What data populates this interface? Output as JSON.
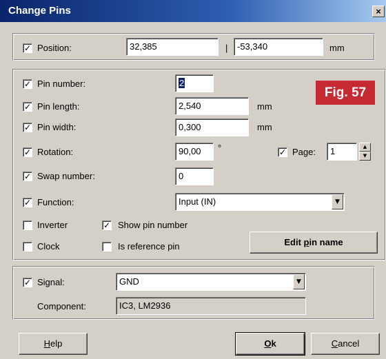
{
  "window": {
    "title": "Change Pins",
    "close_glyph": "×"
  },
  "badge": {
    "text": "Fig. 57",
    "color": "#c62b33"
  },
  "position": {
    "label": "Position:",
    "checked": true,
    "x_value": "32,385",
    "separator": "|",
    "y_value": "-53,340",
    "unit": "mm"
  },
  "pin_number": {
    "label": "Pin number:",
    "checked": true,
    "value": "2"
  },
  "pin_length": {
    "label": "Pin length:",
    "checked": true,
    "value": "2,540",
    "unit": "mm"
  },
  "pin_width": {
    "label": "Pin width:",
    "checked": true,
    "value": "0,300",
    "unit": "mm"
  },
  "rotation": {
    "label": "Rotation:",
    "checked": true,
    "value": "90,00",
    "unit": "°"
  },
  "page": {
    "label": "Page:",
    "checked": true,
    "value": "1"
  },
  "swap_number": {
    "label": "Swap number:",
    "checked": true,
    "value": "0"
  },
  "function": {
    "label": "Function:",
    "checked": true,
    "selected": "Input (IN)"
  },
  "inverter": {
    "label": "Inverter",
    "checked": false
  },
  "show_pin_number": {
    "label": "Show pin number",
    "checked": true
  },
  "clock": {
    "label": "Clock",
    "checked": false
  },
  "is_reference_pin": {
    "label": "Is reference pin",
    "checked": false
  },
  "edit_pin_name": {
    "pre": "Edit ",
    "accel": "p",
    "post": "in name"
  },
  "signal": {
    "label": "Signal:",
    "checked": true,
    "selected": "GND"
  },
  "component": {
    "label": "Component:",
    "value": "IC3, LM2936"
  },
  "buttons": {
    "help": {
      "accel": "H",
      "rest": "elp"
    },
    "ok": {
      "accel": "O",
      "rest": "k"
    },
    "cancel": {
      "accel": "C",
      "rest": "ancel"
    }
  },
  "icons": {
    "check": "check-icon",
    "dropdown": "chevron-down-icon",
    "spin_up": "arrow-up-icon",
    "spin_down": "arrow-down-icon",
    "close": "close-icon"
  }
}
